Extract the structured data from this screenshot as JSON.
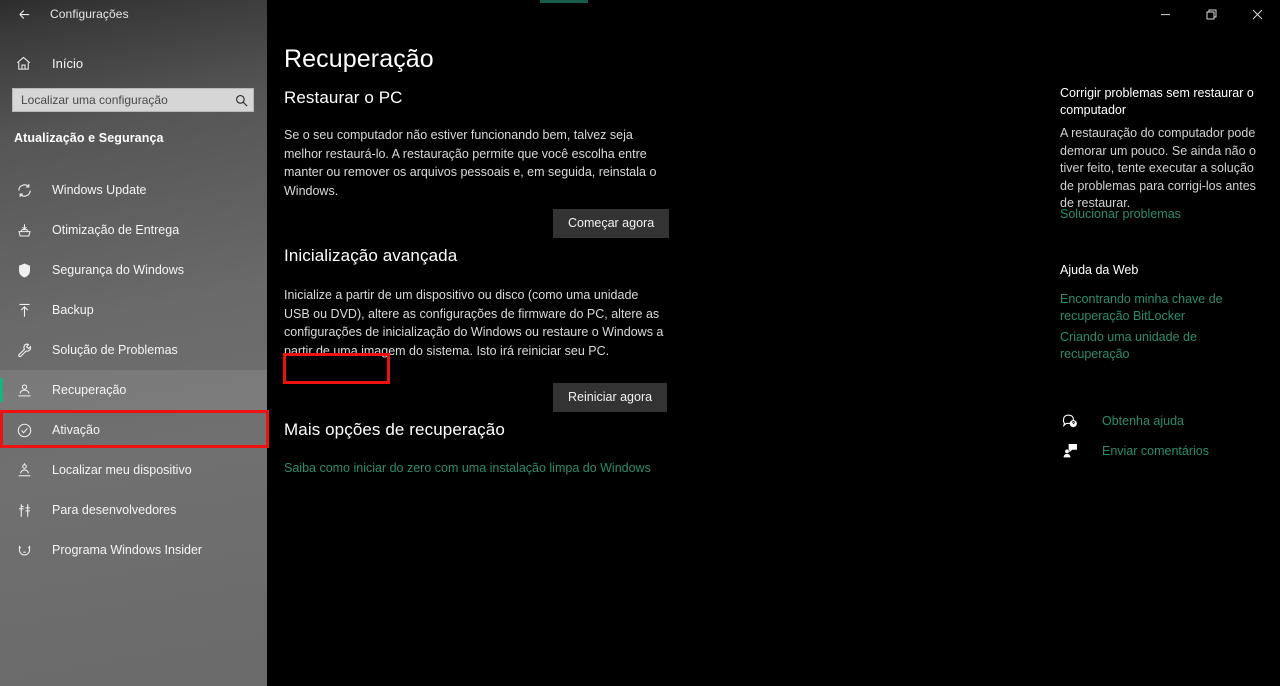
{
  "window": {
    "title": "Configurações",
    "back_icon": "arrow-left-icon",
    "controls": [
      {
        "name": "minimize",
        "icon": "minimize-icon"
      },
      {
        "name": "maximize",
        "icon": "restore-icon"
      },
      {
        "name": "close",
        "icon": "close-icon"
      }
    ],
    "accent_color": "#1b6b5a"
  },
  "sidebar": {
    "home": {
      "label": "Início",
      "icon": "home-icon"
    },
    "search": {
      "placeholder": "Localizar uma configuração",
      "value": "",
      "icon": "search-icon"
    },
    "group_title": "Atualização e Segurança",
    "selected_color": "#16b47f",
    "items": [
      {
        "label": "Windows Update",
        "icon": "sync-icon",
        "selected": false
      },
      {
        "label": "Otimização de Entrega",
        "icon": "delivery-icon",
        "selected": false
      },
      {
        "label": "Segurança do Windows",
        "icon": "shield-icon",
        "selected": false
      },
      {
        "label": "Backup",
        "icon": "upload-icon",
        "selected": false
      },
      {
        "label": "Solução de Problemas",
        "icon": "wrench-icon",
        "selected": false
      },
      {
        "label": "Recuperação",
        "icon": "recovery-icon",
        "selected": true
      },
      {
        "label": "Ativação",
        "icon": "check-circle-icon",
        "selected": false
      },
      {
        "label": "Localizar meu dispositivo",
        "icon": "locate-device-icon",
        "selected": false
      },
      {
        "label": "Para desenvolvedores",
        "icon": "dev-tools-icon",
        "selected": false
      },
      {
        "label": "Programa Windows Insider",
        "icon": "insider-cat-icon",
        "selected": false
      }
    ]
  },
  "main": {
    "page_title": "Recuperação",
    "section1": {
      "heading": "Restaurar o PC",
      "body": "Se o seu computador não estiver funcionando bem, talvez seja melhor restaurá-lo. A restauração permite que você escolha entre manter ou remover os arquivos pessoais e, em seguida, reinstala o Windows.",
      "button": "Começar agora"
    },
    "section2": {
      "heading": "Inicialização avançada",
      "body": "Inicialize a partir de um dispositivo ou disco (como uma unidade USB ou DVD), altere as configurações de firmware do PC, altere as configurações de inicialização do Windows ou restaure o Windows a partir de uma imagem do sistema. Isto irá reiniciar seu PC.",
      "button": "Reiniciar agora"
    },
    "section3": {
      "heading": "Mais opções de recuperação",
      "link": "Saiba como iniciar do zero com uma instalação limpa do Windows"
    }
  },
  "rail": {
    "block1": {
      "heading": "Corrigir problemas sem restaurar o computador",
      "body": "A restauração do computador pode demorar um pouco. Se ainda não o tiver feito, tente executar a solução de problemas para corrigi-los antes de restaurar.",
      "link": "Solucionar problemas"
    },
    "block2": {
      "heading": "Ajuda da Web",
      "links": [
        "Encontrando minha chave de recuperação BitLocker",
        "Criando uma unidade de recuperação"
      ]
    },
    "actions": [
      {
        "label": "Obtenha ajuda",
        "icon": "help-question-icon"
      },
      {
        "label": "Enviar comentários",
        "icon": "feedback-person-icon"
      }
    ],
    "link_color": "#2a8c6e"
  },
  "annotations": {
    "color": "#ee1111",
    "boxes": [
      {
        "target": "sidebar-item-ativacao"
      },
      {
        "target": "restart-now-button"
      }
    ]
  }
}
